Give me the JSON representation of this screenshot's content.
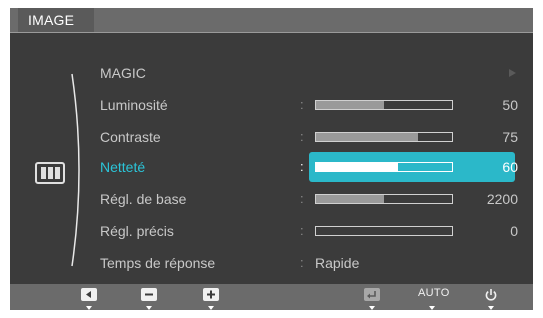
{
  "header": {
    "title": "IMAGE"
  },
  "category_icon": "picture-mode-icon",
  "menu": {
    "items": [
      {
        "label": "MAGIC",
        "kind": "submenu",
        "icon": "arrow-right-icon"
      },
      {
        "label": "Luminosité",
        "kind": "slider",
        "value": "50",
        "level": 0.5
      },
      {
        "label": "Contraste",
        "kind": "slider",
        "value": "75",
        "level": 0.75
      },
      {
        "label": "Netteté",
        "kind": "slider",
        "value": "60",
        "level": 0.6,
        "selected": true
      },
      {
        "label": "Régl. de base",
        "kind": "slider",
        "value": "2200",
        "level": 0.5
      },
      {
        "label": "Régl. précis",
        "kind": "slider",
        "value": "0",
        "level": 0.0
      },
      {
        "label": "Temps de réponse",
        "kind": "text",
        "value": "Rapide"
      }
    ],
    "separator": ":"
  },
  "footer": {
    "auto_label": "AUTO",
    "buttons": [
      "left-arrow-icon",
      "minus-icon",
      "plus-icon",
      "enter-icon",
      "auto",
      "power-icon"
    ]
  },
  "colors": {
    "background": "#3b3b3b",
    "header": "#6b6b6b",
    "accent": "#2bb8c9",
    "text": "#c8c8c8"
  }
}
